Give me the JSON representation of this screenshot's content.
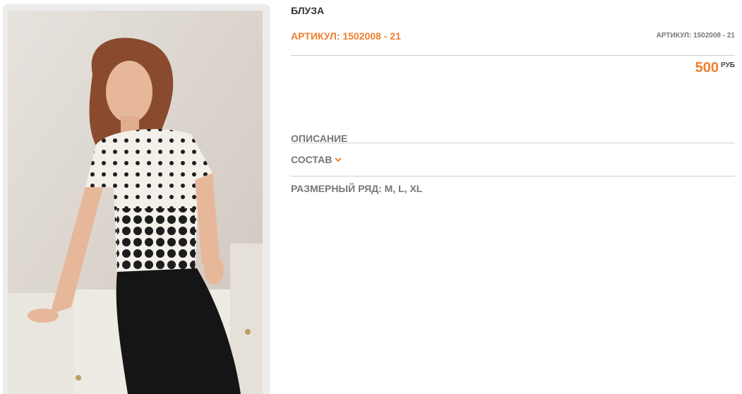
{
  "product": {
    "title": "БЛУЗА",
    "sku_main": "АРТИКУЛ: 1502008 - 21",
    "sku_side": "АРТИКУЛ: 1502008 - 21",
    "price_value": "500",
    "price_currency": "РУБ",
    "image_alt": "Product photo: model in black-and-white polka dot blouse and black trousers"
  },
  "sections": {
    "description_label": "ОПИСАНИЕ",
    "composition_label": "СОСТАВ",
    "sizes_text": "РАЗМЕРНЫЙ РЯД: M, L, XL"
  },
  "icons": {
    "composition_toggle": "chevron-down-icon"
  },
  "colors": {
    "accent": "#f07f2c",
    "text_dark": "#333333",
    "text_muted": "#777777",
    "divider": "#cfcfcf"
  }
}
